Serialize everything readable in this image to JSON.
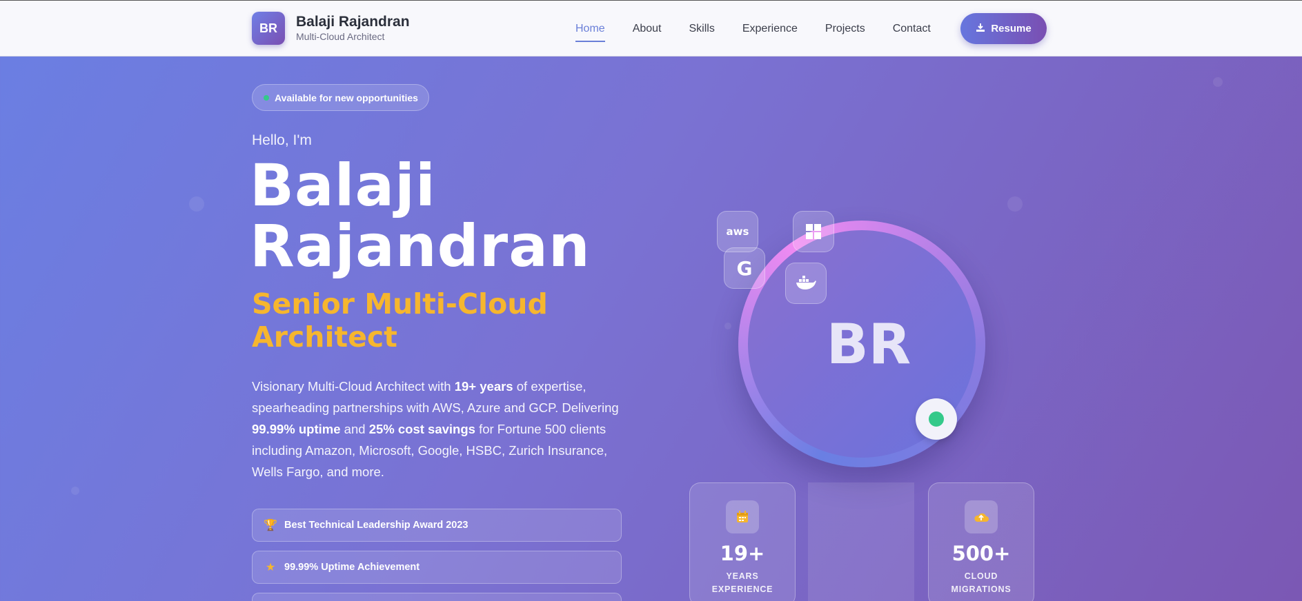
{
  "nav": {
    "logo_initials": "BR",
    "brand_name": "Balaji Rajandran",
    "brand_subtitle": "Multi-Cloud Architect",
    "links": [
      "Home",
      "About",
      "Skills",
      "Experience",
      "Projects",
      "Contact"
    ],
    "active_link": "Home",
    "resume_label": "Resume",
    "resume_icon": "download-icon"
  },
  "hero": {
    "availability": "Available for new opportunities",
    "greeting": "Hello, I'm",
    "name_line1": "Balaji",
    "name_line2": "Rajandran",
    "role_line1": "Senior Multi-Cloud",
    "role_line2": "Architect",
    "description": {
      "p1": "Visionary Multi-Cloud Architect with ",
      "b1": "19+ years",
      "p2": " of expertise, spearheading partnerships with AWS, Azure and GCP. Delivering ",
      "b2": "99.99% uptime",
      "p3": " and ",
      "b3": "25% cost savings",
      "p4": " for Fortune 500 clients including Amazon, Microsoft, Google, HSBC, Zurich Insurance, Wells Fargo, and more."
    },
    "achievements": [
      {
        "icon": "trophy-icon",
        "label": "Best Technical Leadership Award 2023"
      },
      {
        "icon": "star-icon",
        "label": "99.99% Uptime Achievement"
      }
    ]
  },
  "profile": {
    "initials": "BR",
    "status_color": "#34c98a",
    "tech_icons": [
      {
        "name": "aws-icon",
        "text": "aws"
      },
      {
        "name": "windows-icon",
        "text": ""
      },
      {
        "name": "google-icon",
        "text": "G"
      },
      {
        "name": "docker-icon",
        "text": ""
      }
    ]
  },
  "stats": [
    {
      "icon": "calendar-icon",
      "value": "19+",
      "label_line1": "YEARS",
      "label_line2": "EXPERIENCE"
    },
    {
      "icon": "cloud-upload-icon",
      "value": "500+",
      "label_line1": "CLOUD",
      "label_line2": "MIGRATIONS"
    }
  ],
  "colors": {
    "accent": "#6a7fd8",
    "role": "#f6b62e",
    "status": "#34c98a"
  }
}
